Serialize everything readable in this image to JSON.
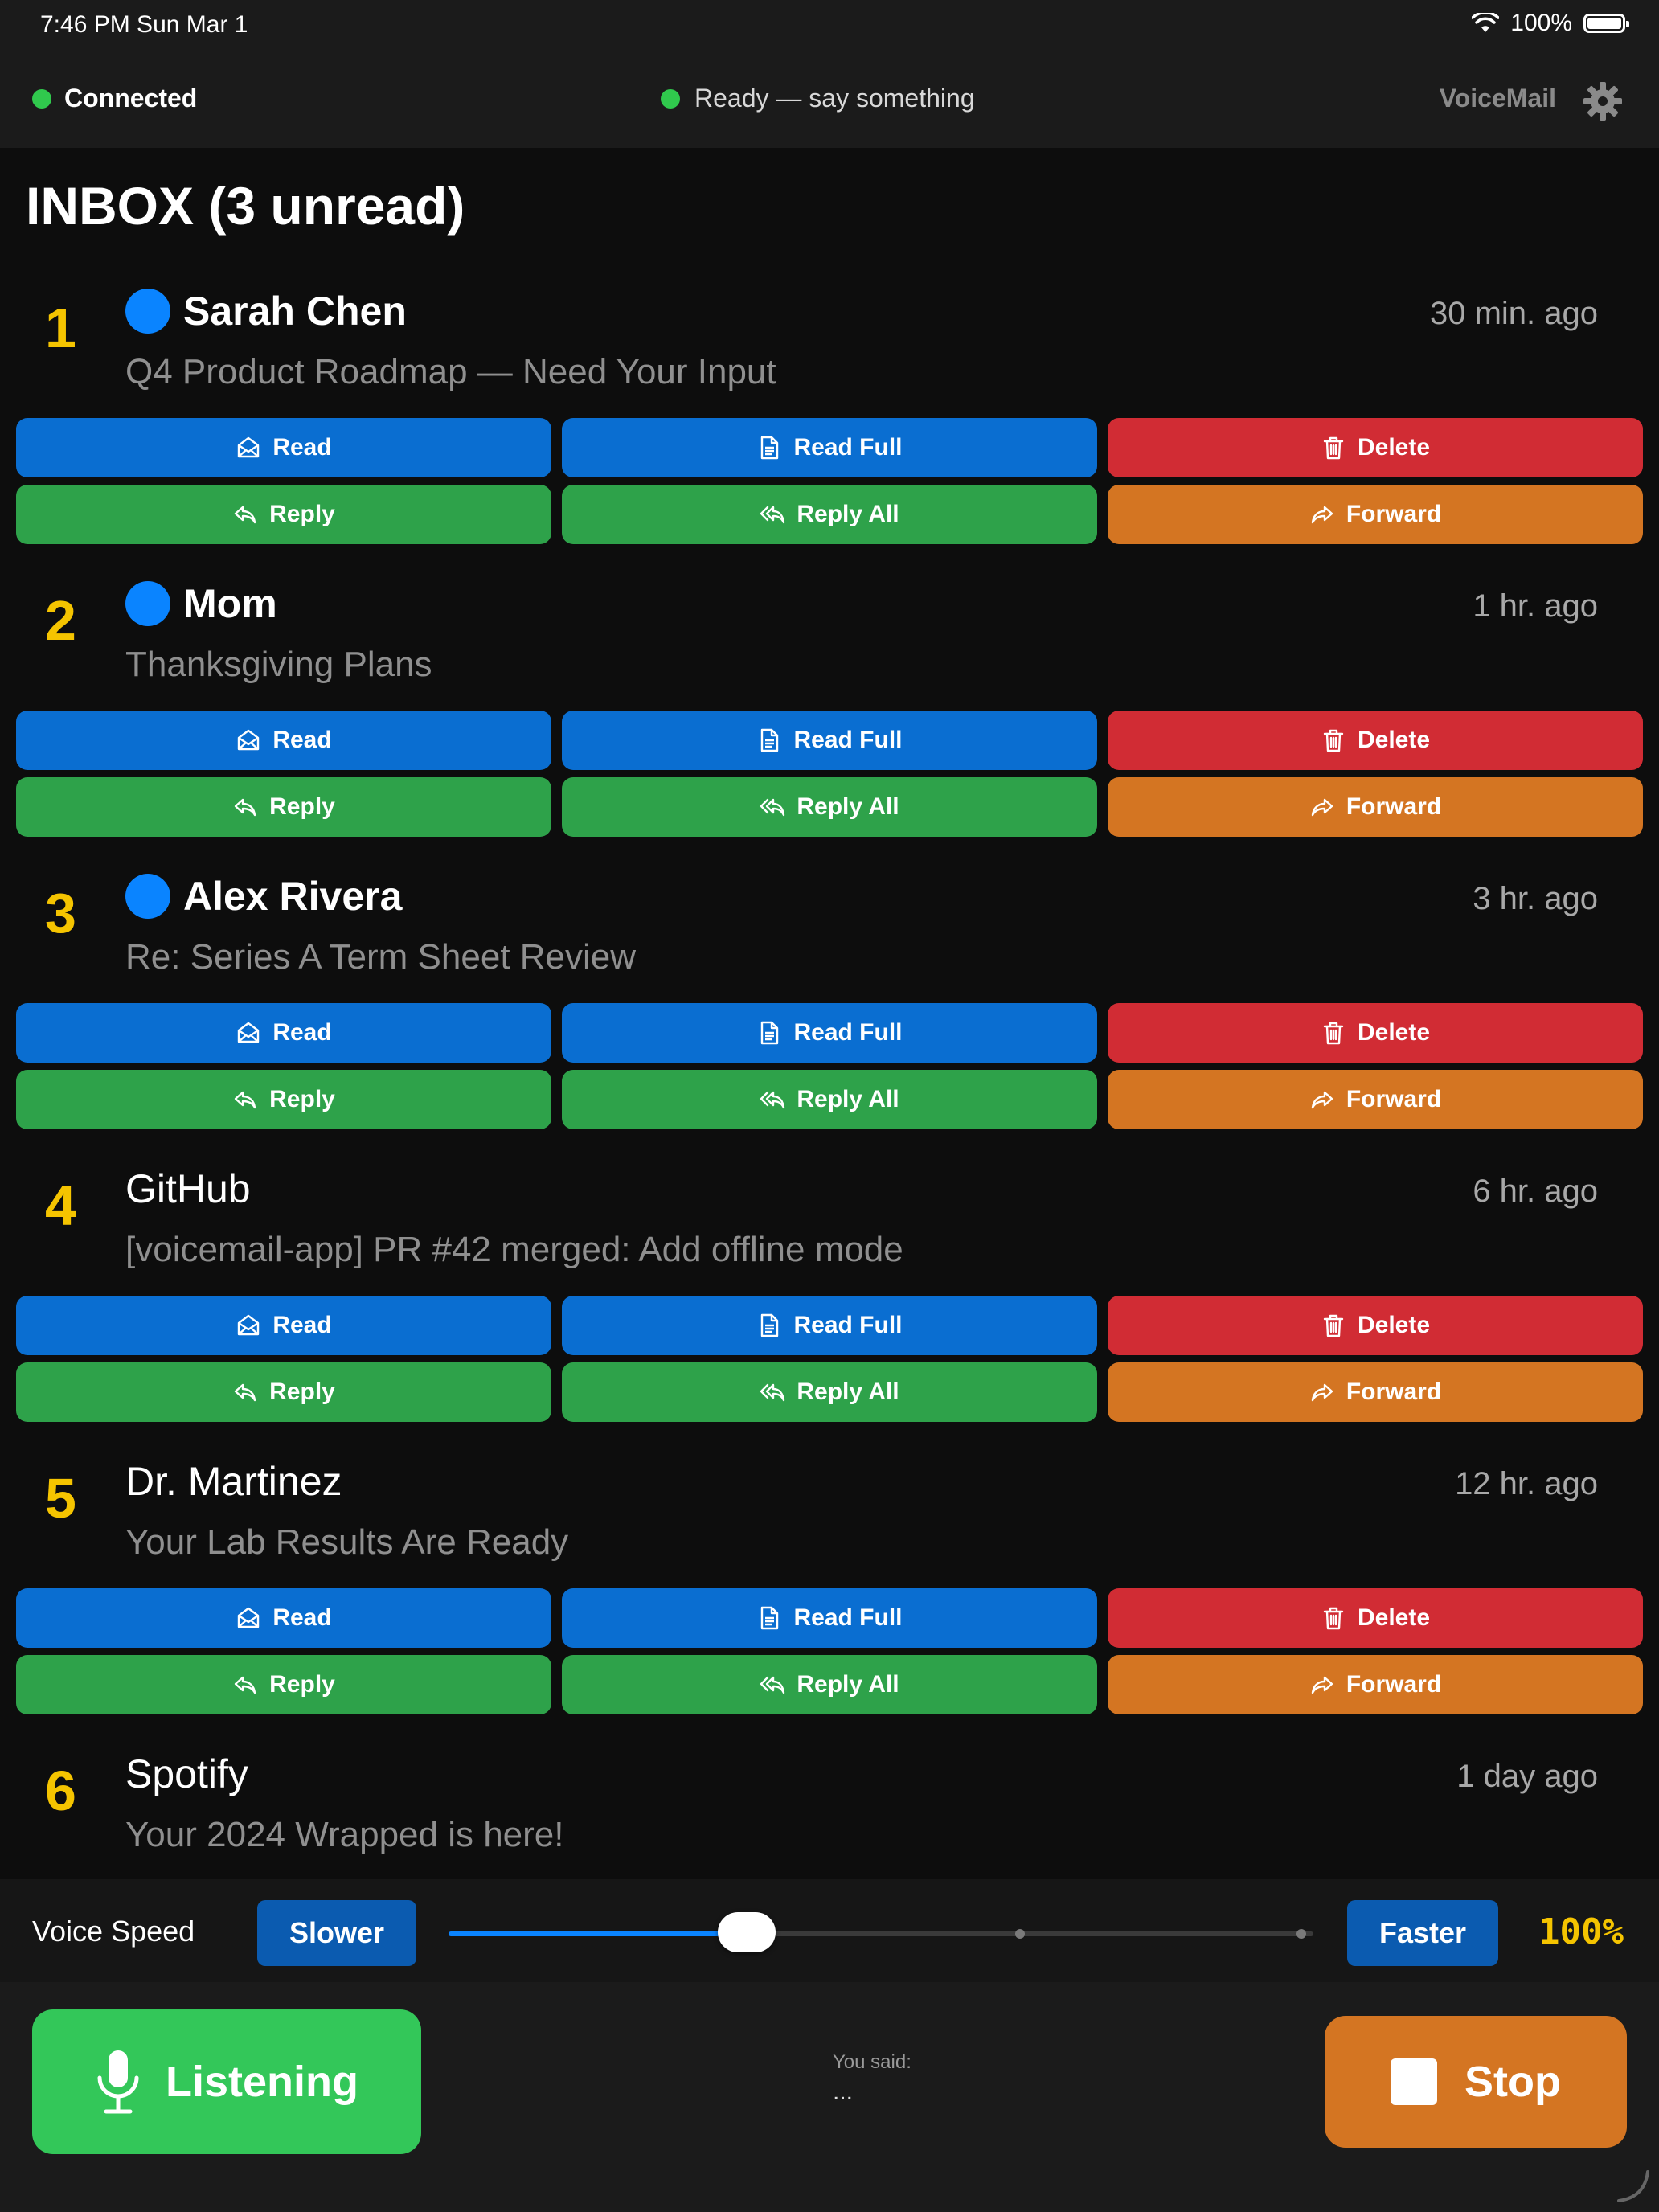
{
  "status_bar": {
    "time": "7:46 PM   Sun Mar 1",
    "battery": "100%"
  },
  "header": {
    "connection": "Connected",
    "status": "Ready — say something",
    "app_name": "VoiceMail",
    "status_color": "#30c94d"
  },
  "inbox": {
    "title": "INBOX (3 unread)",
    "emails": [
      {
        "num": "1",
        "sender": "Sarah Chen",
        "unread": true,
        "time": "30 min. ago",
        "subject": "Q4 Product Roadmap — Need Your Input"
      },
      {
        "num": "2",
        "sender": "Mom",
        "unread": true,
        "time": "1 hr. ago",
        "subject": "Thanksgiving Plans"
      },
      {
        "num": "3",
        "sender": "Alex Rivera",
        "unread": true,
        "time": "3 hr. ago",
        "subject": "Re: Series A Term Sheet Review"
      },
      {
        "num": "4",
        "sender": "GitHub",
        "unread": false,
        "time": "6 hr. ago",
        "subject": "[voicemail-app] PR #42 merged: Add offline mode"
      },
      {
        "num": "5",
        "sender": "Dr. Martinez",
        "unread": false,
        "time": "12 hr. ago",
        "subject": "Your Lab Results Are Ready"
      },
      {
        "num": "6",
        "sender": "Spotify",
        "unread": false,
        "time": "1 day ago",
        "subject": "Your 2024 Wrapped is here!"
      }
    ],
    "actions": [
      {
        "label": "Read",
        "icon": "envelope-open-icon",
        "color": "blue"
      },
      {
        "label": "Read Full",
        "icon": "document-icon",
        "color": "blue"
      },
      {
        "label": "Delete",
        "icon": "trash-icon",
        "color": "red"
      },
      {
        "label": "Reply",
        "icon": "reply-icon",
        "color": "green"
      },
      {
        "label": "Reply All",
        "icon": "reply-all-icon",
        "color": "green"
      },
      {
        "label": "Forward",
        "icon": "forward-icon",
        "color": "orange"
      }
    ]
  },
  "voice_speed": {
    "label": "Voice Speed",
    "slower_label": "Slower",
    "faster_label": "Faster",
    "value_text": "100%",
    "slider_fraction": 0.345
  },
  "controls": {
    "listen_label": "Listening",
    "you_said_label": "You said:",
    "you_said_text": "...",
    "stop_label": "Stop"
  },
  "colors": {
    "accent_blue": "#0a84ff",
    "number_yellow": "#f5c400",
    "listen_green": "#33c759",
    "stop_orange": "#d47522"
  }
}
